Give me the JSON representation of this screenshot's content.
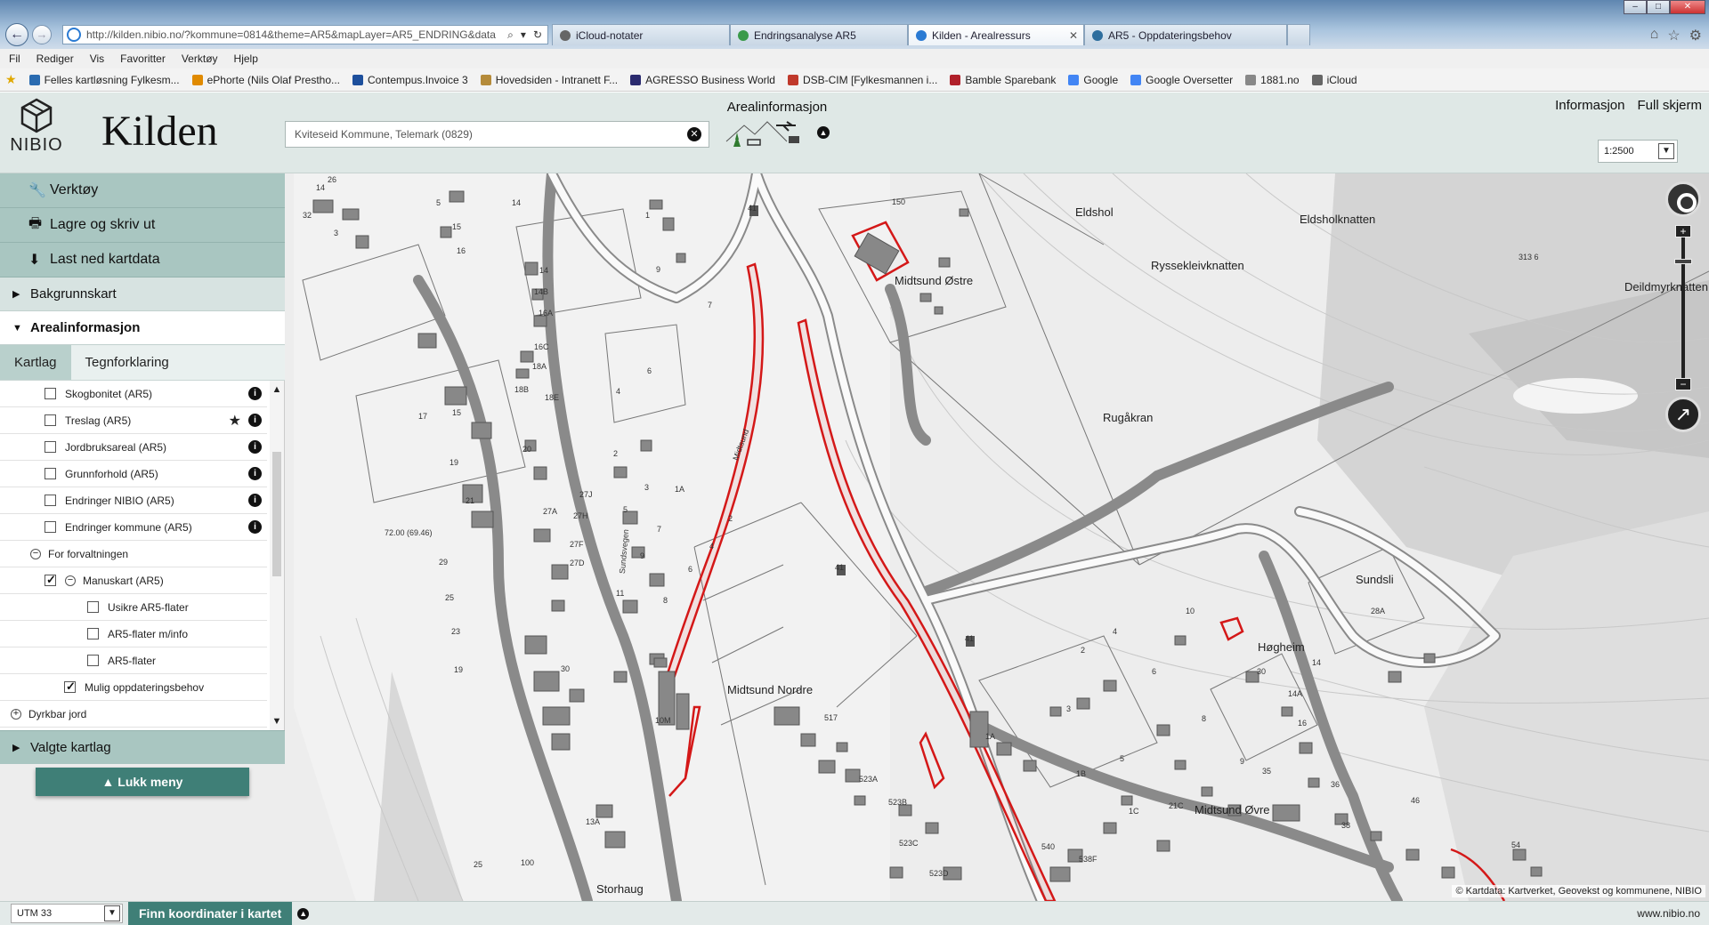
{
  "browser": {
    "url": "http://kilden.nibio.no/?kommune=0814&theme=AR5&mapLayer=AR5_ENDRING&data",
    "window_controls": [
      "–",
      "□",
      "✕"
    ],
    "tabs": [
      {
        "label": "iCloud-notater",
        "active": false,
        "color": "#666666"
      },
      {
        "label": "Endringsanalyse AR5",
        "active": false,
        "color": "#3a9a4a"
      },
      {
        "label": "Kilden - Arealressurs",
        "active": true,
        "color": "#2b7bd3"
      },
      {
        "label": "AR5 - Oppdateringsbehov",
        "active": false,
        "color": "#2e6e9e"
      }
    ],
    "menu": [
      "Fil",
      "Rediger",
      "Vis",
      "Favoritter",
      "Verktøy",
      "Hjelp"
    ],
    "favorites": [
      {
        "label": "Felles kartløsning Fylkesm...",
        "color": "#2a6bb0"
      },
      {
        "label": "ePhorte (Nils Olaf Prestho...",
        "color": "#e08a00"
      },
      {
        "label": "Contempus.Invoice 3",
        "color": "#1d4f9c"
      },
      {
        "label": "Hovedsiden - Intranett F...",
        "color": "#b58b3a"
      },
      {
        "label": "AGRESSO Business World",
        "color": "#2a2a6e"
      },
      {
        "label": "DSB-CIM [Fylkesmannen i...",
        "color": "#c0392b"
      },
      {
        "label": "Bamble Sparebank",
        "color": "#b0202a"
      },
      {
        "label": "Google",
        "color": "#4285f4"
      },
      {
        "label": "Google Oversetter",
        "color": "#4285f4"
      },
      {
        "label": "1881.no",
        "color": "#888888"
      },
      {
        "label": "iCloud",
        "color": "#666666"
      }
    ]
  },
  "app": {
    "logo_text": "NIBIO",
    "title": "Kilden",
    "search_value": "Kviteseid Kommune, Telemark (0829)",
    "theme_label": "Arealinformasjon",
    "links": [
      "Informasjon",
      "Full skjerm"
    ],
    "scale": "1:2500"
  },
  "sidebar": {
    "tools": [
      {
        "label": "Verktøy",
        "icon": "wrench-icon",
        "glyph": "🔧"
      },
      {
        "label": "Lagre og skriv ut",
        "icon": "printer-icon",
        "glyph": "🖶"
      },
      {
        "label": "Last ned kartdata",
        "icon": "download-icon",
        "glyph": "⬇"
      }
    ],
    "background_label": "Bakgrunnskart",
    "area_label": "Arealinformasjon",
    "subtabs": [
      "Kartlag",
      "Tegnforklaring"
    ],
    "layers": [
      {
        "label": "Skogbonitet (AR5)",
        "checked": false,
        "info": true,
        "star": false
      },
      {
        "label": "Treslag (AR5)",
        "checked": false,
        "info": true,
        "star": true
      },
      {
        "label": "Jordbruksareal (AR5)",
        "checked": false,
        "info": true,
        "star": false
      },
      {
        "label": "Grunnforhold (AR5)",
        "checked": false,
        "info": true,
        "star": false
      },
      {
        "label": "Endringer NIBIO (AR5)",
        "checked": false,
        "info": true,
        "star": false
      },
      {
        "label": "Endringer kommune (AR5)",
        "checked": false,
        "info": true,
        "star": false
      }
    ],
    "group_label": "For forvaltningen",
    "manuskart_label": "Manuskart (AR5)",
    "sublayers": [
      {
        "label": "Usikre AR5-flater",
        "checked": false
      },
      {
        "label": "AR5-flater m/info",
        "checked": false
      },
      {
        "label": "AR5-flater",
        "checked": false
      }
    ],
    "mulig_label": "Mulig oppdateringsbehov",
    "dyrkbar_label": "Dyrkbar jord",
    "selected_layers_label": "Valgte kartlag",
    "close_menu_label": "▲ Lukk meny"
  },
  "map": {
    "attribution": "© Kartdata: Kartverket, Geovekst og kommunene, NIBIO",
    "place_names": [
      "Eldshol",
      "Eldsholknatten",
      "Ryssekleivknatten",
      "Midtsund Østre",
      "Deildmyrknatten",
      "Rugåkran",
      "Sundsli",
      "Høgheim",
      "Midtsund Nordre",
      "Midtsund Øvre",
      "Storhaug"
    ],
    "labels": [
      "14",
      "26",
      "32",
      "5",
      "15",
      "14",
      "16",
      "1",
      "3",
      "9",
      "14B",
      "14",
      "16A",
      "16C",
      "18A",
      "18B",
      "18E",
      "2",
      "4",
      "6",
      "7",
      "17",
      "15",
      "19",
      "20",
      "21",
      "27A",
      "27J",
      "27H",
      "27F",
      "27D",
      "5",
      "3",
      "1A",
      "2",
      "4",
      "6",
      "8",
      "7",
      "9",
      "11",
      "29",
      "25",
      "23",
      "19",
      "30",
      "10M",
      "517",
      "523A",
      "523B",
      "523C",
      "523D",
      "540",
      "538F",
      "1A",
      "1B",
      "1C",
      "21C",
      "3",
      "2",
      "4",
      "5",
      "6",
      "8",
      "9",
      "10",
      "14",
      "14A",
      "16",
      "30",
      "35",
      "36",
      "38",
      "46",
      "54",
      "28A",
      "13A",
      "150",
      "313 6",
      "72.00 (69.46)",
      "25",
      "100",
      "41",
      "41",
      "41",
      "Midtsund",
      "Sundsvegen"
    ]
  },
  "bottom": {
    "coord_system": "UTM 33",
    "find_coord_label": "Finn koordinater i kartet",
    "site": "www.nibio.no"
  }
}
